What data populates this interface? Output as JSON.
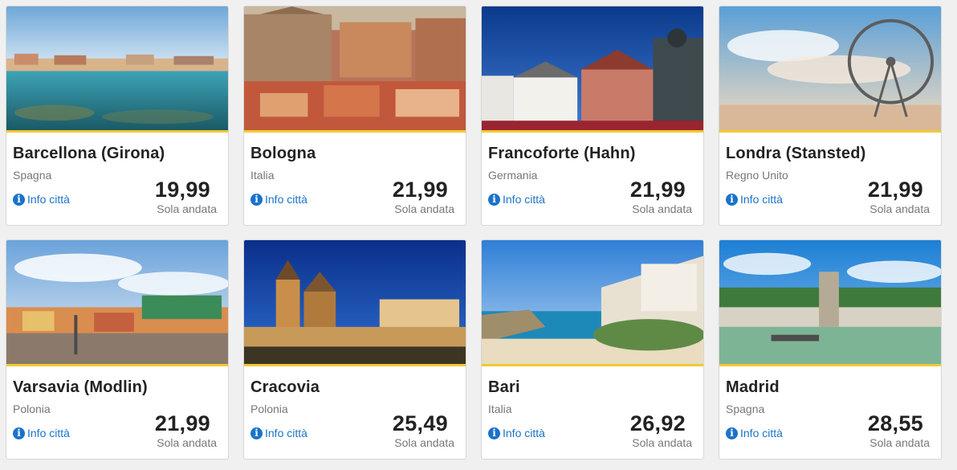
{
  "cards": [
    {
      "city": "Barcellona (Girona)",
      "country": "Spagna",
      "info": "Info città",
      "price": "19,99",
      "trip": "Sola andata"
    },
    {
      "city": "Bologna",
      "country": "Italia",
      "info": "Info città",
      "price": "21,99",
      "trip": "Sola andata"
    },
    {
      "city": "Francoforte (Hahn)",
      "country": "Germania",
      "info": "Info città",
      "price": "21,99",
      "trip": "Sola andata"
    },
    {
      "city": "Londra (Stansted)",
      "country": "Regno Unito",
      "info": "Info città",
      "price": "21,99",
      "trip": "Sola andata"
    },
    {
      "city": "Varsavia (Modlin)",
      "country": "Polonia",
      "info": "Info città",
      "price": "21,99",
      "trip": "Sola andata"
    },
    {
      "city": "Cracovia",
      "country": "Polonia",
      "info": "Info città",
      "price": "25,49",
      "trip": "Sola andata"
    },
    {
      "city": "Bari",
      "country": "Italia",
      "info": "Info città",
      "price": "26,92",
      "trip": "Sola andata"
    },
    {
      "city": "Madrid",
      "country": "Spagna",
      "info": "Info città",
      "price": "28,55",
      "trip": "Sola andata"
    }
  ],
  "colors": {
    "accent_border": "#f1c933",
    "link": "#1a73c9",
    "text": "#222222",
    "muted": "#777777"
  },
  "icons": {
    "info": "info-circle-icon"
  }
}
